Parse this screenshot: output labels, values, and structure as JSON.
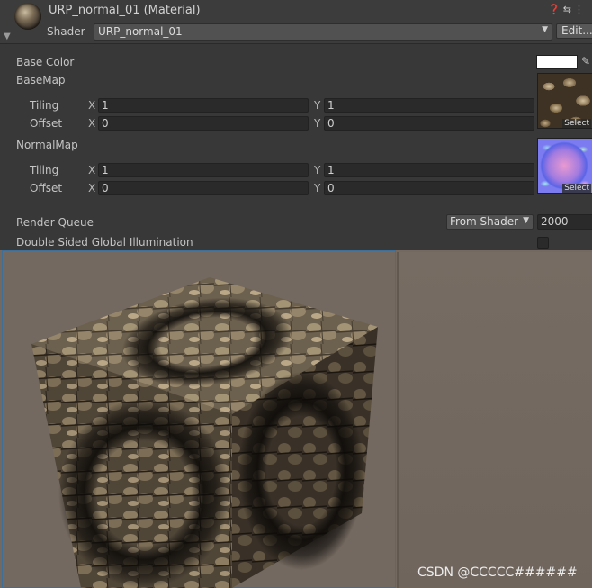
{
  "header": {
    "title": "URP_normal_01 (Material)",
    "shader_label": "Shader",
    "shader_value": "URP_normal_01",
    "edit_label": "Edit...",
    "icons": [
      "help-icon",
      "preset-icon",
      "kebab-menu-icon"
    ]
  },
  "properties": {
    "base_color_label": "Base Color",
    "base_color_value": "#ffffff",
    "basemap_label": "BaseMap",
    "basemap": {
      "tiling_label": "Tiling",
      "offset_label": "Offset",
      "tiling_x": "1",
      "tiling_y": "1",
      "offset_x": "0",
      "offset_y": "0",
      "select_label": "Select"
    },
    "normalmap_label": "NormalMap",
    "normalmap": {
      "tiling_label": "Tiling",
      "offset_label": "Offset",
      "tiling_x": "1",
      "tiling_y": "1",
      "offset_x": "0",
      "offset_y": "0",
      "select_label": "Select"
    },
    "x_label": "X",
    "y_label": "Y",
    "render_queue_label": "Render Queue",
    "render_queue_mode": "From Shader",
    "render_queue_value": "2000",
    "dsgi_label": "Double Sided Global Illumination",
    "dsgi_checked": false
  },
  "preview": {
    "background": "#746960",
    "watermark": "CSDN @CCCCC######"
  }
}
